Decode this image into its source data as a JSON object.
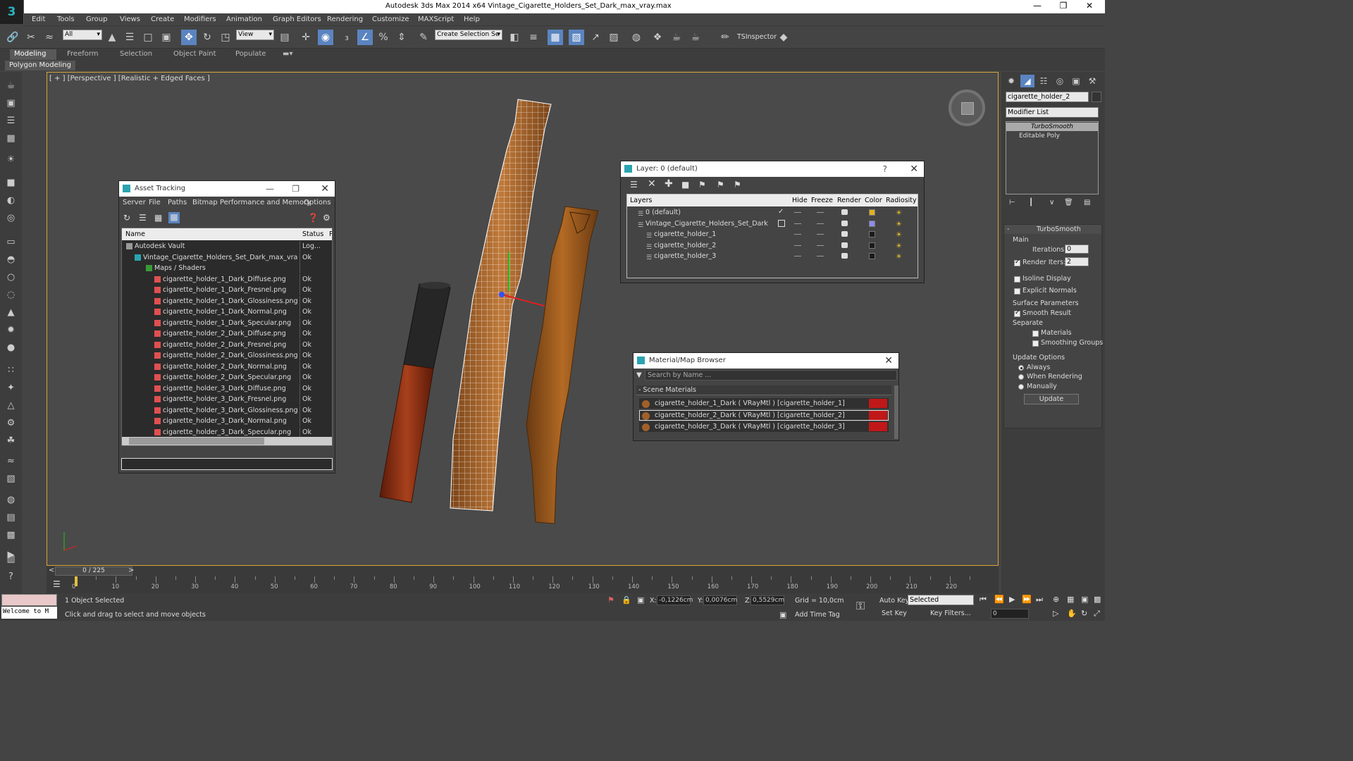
{
  "app": {
    "title": "Autodesk 3ds Max  2014 x64     Vintage_Cigarette_Holders_Set_Dark_max_vray.max",
    "logo": "3",
    "window_controls": [
      "—",
      "❐",
      "✕"
    ]
  },
  "menu": [
    "Edit",
    "Tools",
    "Group",
    "Views",
    "Create",
    "Modifiers",
    "Animation",
    "Graph Editors",
    "Rendering",
    "Customize",
    "MAXScript",
    "Help"
  ],
  "toolbar": {
    "filter_value": "All",
    "coord_value": "View",
    "selection_set_placeholder": "Create Selection Se",
    "tsinspector_label": "TSInspector"
  },
  "ribbon": {
    "tabs": [
      "Modeling",
      "Freeform",
      "Selection",
      "Object Paint",
      "Populate"
    ],
    "active_tab": "Modeling",
    "panel_label": "Polygon Modeling"
  },
  "viewport": {
    "label": "[ + ] [Perspective ] [Realistic + Edged Faces ]"
  },
  "asset_tracking": {
    "title": "Asset Tracking",
    "menu": [
      "Server",
      "File",
      "Paths",
      "Bitmap Performance and Memory",
      "Options"
    ],
    "columns": [
      "Name",
      "Status",
      "P"
    ],
    "rows": [
      {
        "name": "Autodesk Vault",
        "status": "Log..."
      },
      {
        "name": "Vintage_Cigarette_Holders_Set_Dark_max_vra...",
        "status": "Ok"
      },
      {
        "name": "Maps / Shaders",
        "status": ""
      },
      {
        "name": "cigarette_holder_1_Dark_Diffuse.png",
        "status": "Ok"
      },
      {
        "name": "cigarette_holder_1_Dark_Fresnel.png",
        "status": "Ok"
      },
      {
        "name": "cigarette_holder_1_Dark_Glossiness.png",
        "status": "Ok"
      },
      {
        "name": "cigarette_holder_1_Dark_Normal.png",
        "status": "Ok"
      },
      {
        "name": "cigarette_holder_1_Dark_Specular.png",
        "status": "Ok"
      },
      {
        "name": "cigarette_holder_2_Dark_Diffuse.png",
        "status": "Ok"
      },
      {
        "name": "cigarette_holder_2_Dark_Fresnel.png",
        "status": "Ok"
      },
      {
        "name": "cigarette_holder_2_Dark_Glossiness.png",
        "status": "Ok"
      },
      {
        "name": "cigarette_holder_2_Dark_Normal.png",
        "status": "Ok"
      },
      {
        "name": "cigarette_holder_2_Dark_Specular.png",
        "status": "Ok"
      },
      {
        "name": "cigarette_holder_3_Dark_Diffuse.png",
        "status": "Ok"
      },
      {
        "name": "cigarette_holder_3_Dark_Fresnel.png",
        "status": "Ok"
      },
      {
        "name": "cigarette_holder_3_Dark_Glossiness.png",
        "status": "Ok"
      },
      {
        "name": "cigarette_holder_3_Dark_Normal.png",
        "status": "Ok"
      },
      {
        "name": "cigarette_holder_3_Dark_Specular.png",
        "status": "Ok"
      }
    ]
  },
  "layer_dialog": {
    "title": "Layer: 0 (default)",
    "help": "?",
    "columns": [
      "Layers",
      "Hide",
      "Freeze",
      "Render",
      "Color",
      "Radiosity"
    ],
    "rows": [
      {
        "name": "0 (default)",
        "color": "#e0b020"
      },
      {
        "name": "Vintage_Cigarette_Holders_Set_Dark",
        "color": "#8c8cf0"
      },
      {
        "name": "cigarette_holder_1",
        "color": "#1a1a1a"
      },
      {
        "name": "cigarette_holder_2",
        "color": "#1a1a1a"
      },
      {
        "name": "cigarette_holder_3",
        "color": "#1a1a1a"
      }
    ]
  },
  "material_browser": {
    "title": "Material/Map Browser",
    "search_placeholder": "Search by Name ...",
    "section": "- Scene Materials",
    "items": [
      "cigarette_holder_1_Dark  ( VRayMtl )  [cigarette_holder_1]",
      "cigarette_holder_2_Dark  ( VRayMtl )  [cigarette_holder_2]",
      "cigarette_holder_3_Dark  ( VRayMtl )  [cigarette_holder_3]"
    ]
  },
  "command_panel": {
    "object_name": "cigarette_holder_2",
    "modifier_list": "Modifier List",
    "stack": [
      "TurboSmooth",
      "Editable Poly"
    ],
    "turbosmooth": {
      "title": "TurboSmooth",
      "main": "Main",
      "iterations_label": "Iterations:",
      "iterations": "0",
      "render_iters_label": "Render Iters:",
      "render_iters": "2",
      "isoline": "Isoline Display",
      "explicit": "Explicit Normals",
      "surface": "Surface Parameters",
      "smooth_result": "Smooth Result",
      "separate": "Separate",
      "materials": "Materials",
      "smoothing_groups": "Smoothing Groups",
      "update_options": "Update Options",
      "always": "Always",
      "when_rendering": "When Rendering",
      "manually": "Manually",
      "update_button": "Update"
    }
  },
  "timeline": {
    "frame": "0 / 225",
    "prev": "<",
    "next": ">",
    "ticks": [
      "0",
      "10",
      "20",
      "30",
      "40",
      "50",
      "60",
      "70",
      "80",
      "90",
      "100",
      "110",
      "120",
      "130",
      "140",
      "150",
      "160",
      "170",
      "180",
      "190",
      "200",
      "210",
      "220"
    ]
  },
  "status": {
    "listener": "Welcome to M",
    "selected": "1 Object Selected",
    "hint": "Click and drag to select and move objects",
    "x_label": "X:",
    "x": "-0,1226cm",
    "y_label": "Y:",
    "y": "0,0076cm",
    "z_label": "Z:",
    "z": "0,5529cm",
    "grid": "Grid = 10,0cm",
    "add_time_tag": "Add Time Tag",
    "auto_key": "Auto Key",
    "set_key": "Set Key",
    "selected_dropdown": "Selected",
    "key_filters": "Key Filters...",
    "frame_value": "0"
  },
  "colors": {
    "accent": "#5b84c0",
    "viewport_border": "#d8a43a",
    "material_swatch": "#c01818"
  }
}
